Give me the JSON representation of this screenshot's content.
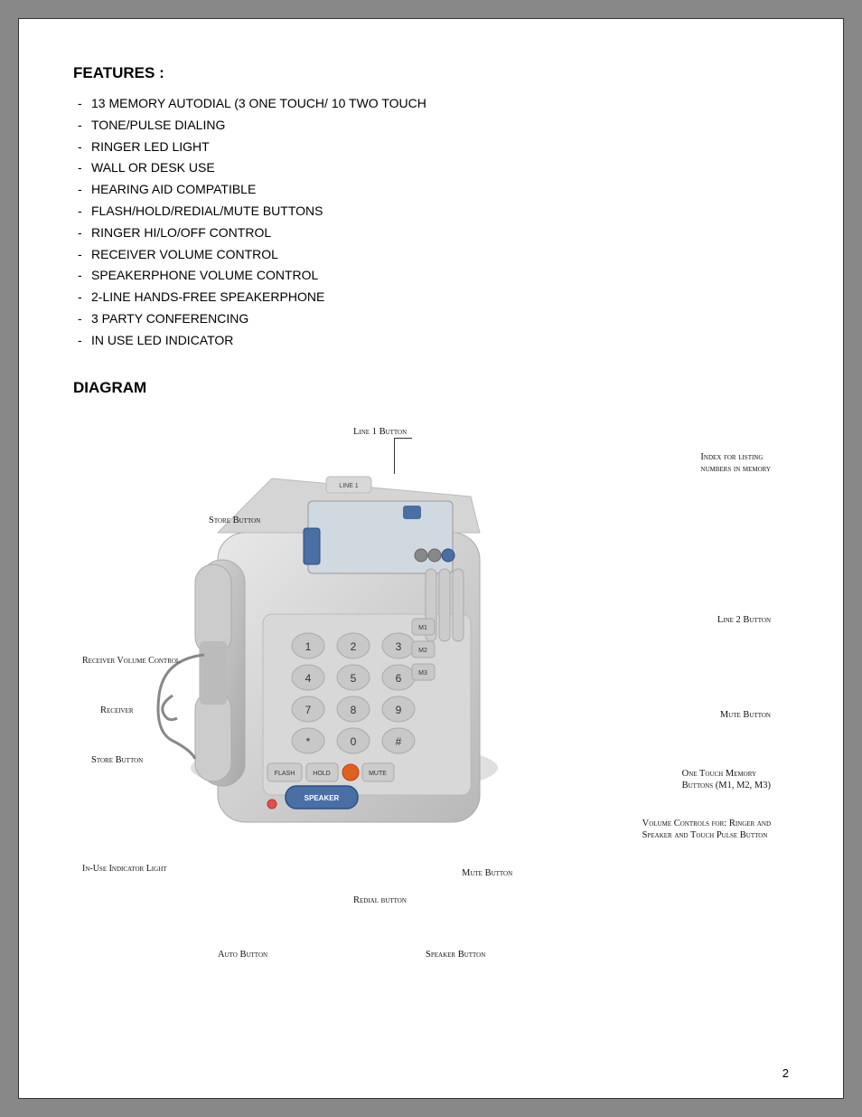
{
  "page": {
    "number": "2"
  },
  "features": {
    "title": "FEATURES :",
    "items": [
      "13 MEMORY AUTODIAL (3 ONE TOUCH/ 10 TWO TOUCH",
      "TONE/PULSE DIALING",
      "RINGER LED LIGHT",
      "WALL OR DESK USE",
      "HEARING AID COMPATIBLE",
      "FLASH/HOLD/REDIAL/MUTE BUTTONS",
      "RINGER HI/LO/OFF CONTROL",
      "RECEIVER VOLUME CONTROL",
      "SPEAKERPHONE VOLUME CONTROL",
      "2-LINE HANDS-FREE SPEAKERPHONE",
      "3 PARTY CONFERENCING",
      "IN USE LED INDICATOR"
    ]
  },
  "diagram": {
    "title": "DIAGRAM",
    "labels": {
      "line1_button": "Line 1 Button",
      "index_for_listing": "Index for listing",
      "numbers_in_memory": "numbers in memory",
      "store_button_top": "Store Button",
      "line2_button": "Line 2 Button",
      "receiver_volume_control": "Receiver Volume Control",
      "receiver": "Receiver",
      "mute_button_top": "Mute Button",
      "store_button_bottom": "Store Button",
      "one_touch_memory": "One Touch Memory",
      "buttons_m1m2m3": "Buttons (M1, M2, M3)",
      "volume_controls": "Volume Controls for: Ringer and",
      "speaker_touch_pulse": "Speaker and Touch Pulse Button",
      "in_use_indicator": "In-Use Indicator Light",
      "mute_button_bottom": "Mute Button",
      "redial_button": "Redial button",
      "auto_button": "Auto Button",
      "speaker_button": "Speaker Button"
    }
  }
}
